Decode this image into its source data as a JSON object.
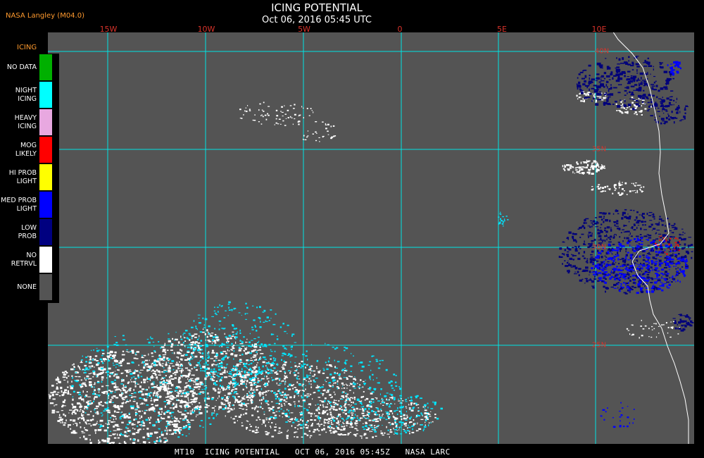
{
  "header": {
    "producer": "NASA Langley (M04.0)",
    "title": "ICING POTENTIAL",
    "subtitle": "Oct 06, 2016 05:45 UTC"
  },
  "legend": {
    "title": "ICING",
    "items": [
      {
        "label": "NO DATA",
        "color": "#00b000"
      },
      {
        "label": "NIGHT\nICING",
        "color": "#00ffff"
      },
      {
        "label": "HEAVY\nICING",
        "color": "#e8a8e0"
      },
      {
        "label": "MOG\nLIKELY",
        "color": "#ff0000"
      },
      {
        "label": "HI PROB\nLIGHT",
        "color": "#ffff00"
      },
      {
        "label": "MED PROB\nLIGHT",
        "color": "#0000ff"
      },
      {
        "label": "LOW\nPROB",
        "color": "#000080"
      },
      {
        "label": "NO\nRETRVL",
        "color": "#ffffff"
      },
      {
        "label": "NONE",
        "color": "#545454"
      }
    ]
  },
  "longitude_labels": [
    "15W",
    "10W",
    "5W",
    "0",
    "5E",
    "10E"
  ],
  "latitude_labels": [
    "40N",
    "35N",
    "30N",
    "25N"
  ],
  "footer": "MT10  ICING POTENTIAL   OCT 06, 2016 05:45Z   NASA LARC",
  "colors": {
    "background": "#545454",
    "grid": "#00e5e5",
    "grid_label": "#d9332b",
    "coastline": "#ffffff"
  }
}
